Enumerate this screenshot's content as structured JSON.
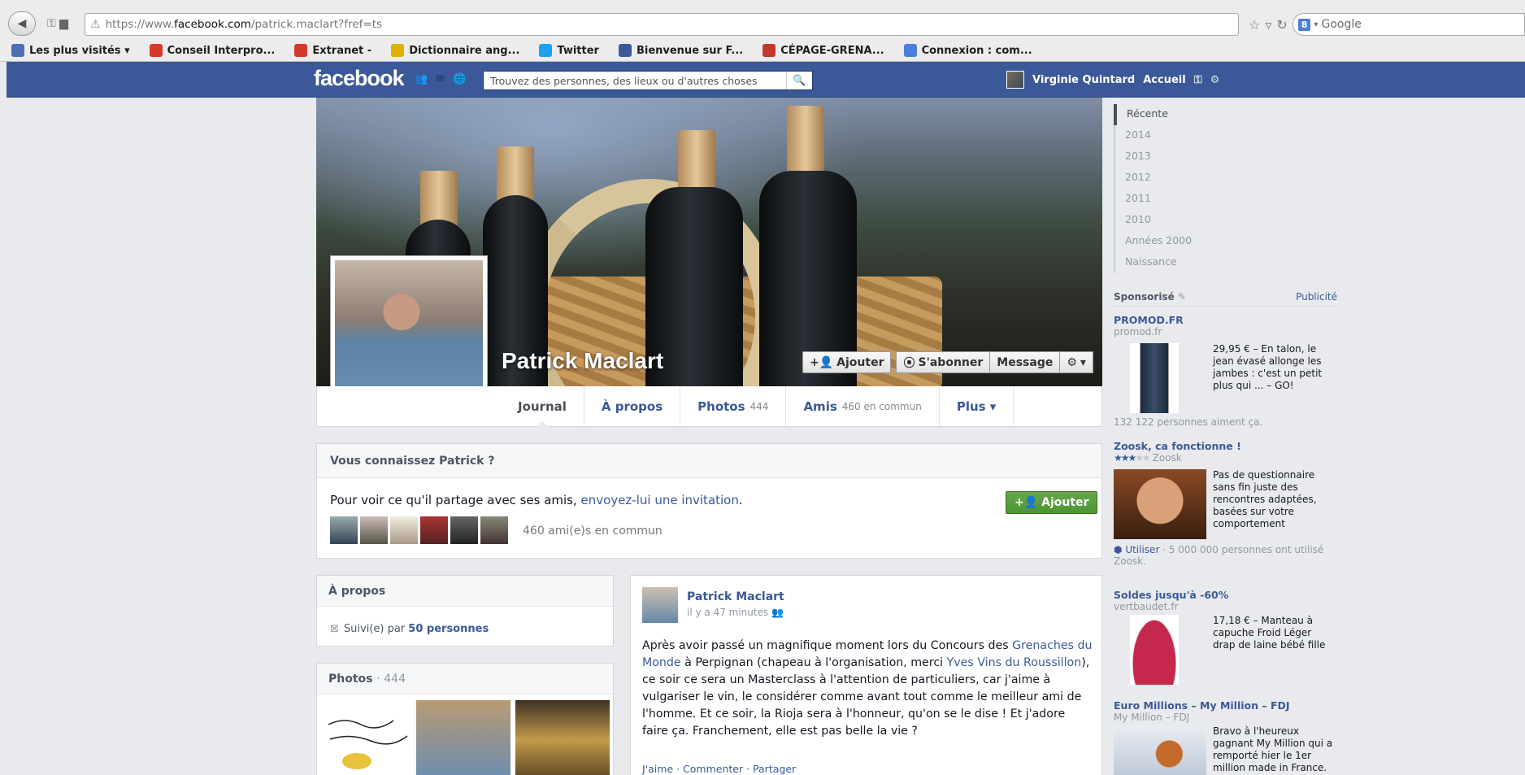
{
  "browser": {
    "url_prefix": "https://www.",
    "url_domain": "facebook.com",
    "url_path": "/patrick.maclart?fref=ts",
    "search_engine_label": "Google",
    "bookmarks": [
      {
        "label": "Les plus visités ▾",
        "color": "#4a6fb5"
      },
      {
        "label": "Conseil Interpro...",
        "color": "#d33a2c"
      },
      {
        "label": "Extranet -",
        "color": "#d33a2c"
      },
      {
        "label": "Dictionnaire ang...",
        "color": "#e0b000"
      },
      {
        "label": "Twitter",
        "color": "#1da1f2"
      },
      {
        "label": "Bienvenue sur F...",
        "color": "#3b5998"
      },
      {
        "label": "CÉPAGE-GRENA...",
        "color": "#c0392b"
      },
      {
        "label": "Connexion : com...",
        "color": "#4a7fdb"
      }
    ]
  },
  "fb": {
    "logo": "facebook",
    "search_placeholder": "Trouvez des personnes, des lieux ou d'autres choses",
    "user_name": "Virginie Quintard",
    "home_label": "Accueil"
  },
  "profile": {
    "name": "Patrick Maclart",
    "actions": {
      "add": "Ajouter",
      "follow": "S'abonner",
      "message": "Message"
    },
    "tabs": [
      {
        "label": "Journal",
        "count": ""
      },
      {
        "label": "À propos",
        "count": ""
      },
      {
        "label": "Photos",
        "count": "444"
      },
      {
        "label": "Amis",
        "count": "460 en commun"
      },
      {
        "label": "Plus ▾",
        "count": ""
      }
    ]
  },
  "know": {
    "title": "Vous connaissez Patrick ?",
    "text_prefix": "Pour voir ce qu'il partage avec ses amis, ",
    "text_link": "envoyez-lui une invitation",
    "text_suffix": ".",
    "mutual": "460 ami(e)s en commun",
    "add_label": "Ajouter"
  },
  "apropos": {
    "title": "À propos",
    "followed_prefix": "Suivi(e) par ",
    "followed_link": "50 personnes"
  },
  "photos": {
    "title": "Photos",
    "count": "· 444"
  },
  "post": {
    "author": "Patrick Maclart",
    "time": "il y a 47 minutes",
    "text_1": "Après avoir passé un magnifique moment lors du Concours des ",
    "link_1": "Grenaches du Monde",
    "text_2": " à Perpignan (chapeau à l'organisation, merci ",
    "link_2": "Yves Vins du Roussillon",
    "text_3": "), ce soir ce sera un Masterclass à l'attention de particuliers, car j'aime à vulgariser le vin, le considérer comme avant tout comme le meilleur ami de l'homme. Et ce soir, la Rioja sera à l'honneur, qu'on se le dise ! Et j'adore faire ça. Franchement, elle est pas belle la vie ?",
    "like": "J'aime",
    "comment": "Commenter",
    "share": "Partager"
  },
  "timeline_years": [
    "Récente",
    "2014",
    "2013",
    "2012",
    "2011",
    "2010",
    "Années 2000",
    "Naissance"
  ],
  "ads": {
    "sponsored": "Sponsorisé",
    "publicity": "Publicité",
    "items": [
      {
        "title": "PROMOD.FR",
        "domain": "promod.fr",
        "text": "29,95 € – En talon, le jean évasé allonge les jambes : c'est un petit plus qui ... – GO!",
        "footer": "132 122 personnes aiment ça."
      },
      {
        "title": "Zoosk, ca fonctionne !",
        "domain": "Zoosk",
        "text": "Pas de questionnaire sans fin juste des rencontres adaptées, basées sur votre comportement",
        "footer_link": "Utiliser",
        "footer": " · 5 000 000 personnes ont utilisé Zoosk."
      },
      {
        "title": "Soldes jusqu'à -60%",
        "domain": "vertbaudet.fr",
        "text": "17,18 € – Manteau à capuche Froid Léger drap de laine bébé fille",
        "footer": ""
      },
      {
        "title": "Euro Millions – My Million – FDJ",
        "domain": "My Million – FDJ",
        "text": "Bravo à l'heureux gagnant My Million qui a remporté hier le 1er million made in France.",
        "footer": ""
      }
    ]
  }
}
